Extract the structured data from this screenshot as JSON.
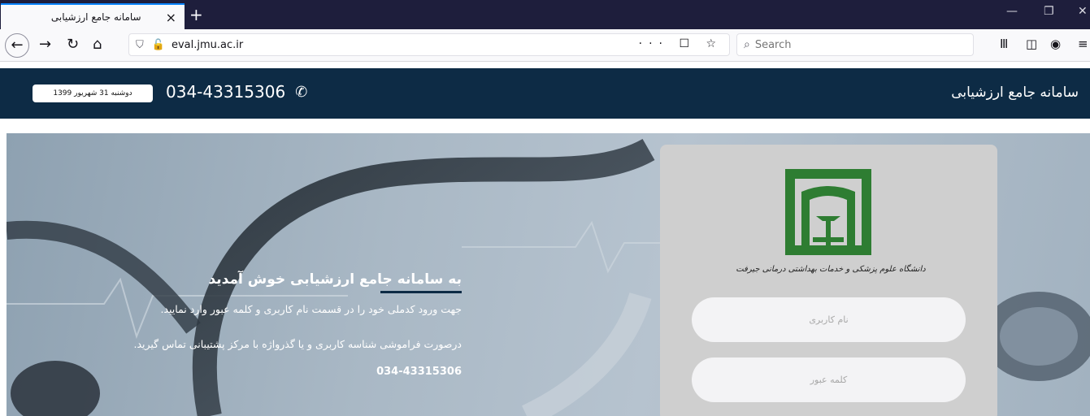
{
  "browser": {
    "tab_title": "سامانه جامع ارزشیابی",
    "tab_close": "×",
    "new_tab": "+",
    "url": "eval.jmu.ac.ir",
    "url_actions": "··· ☐ ☆",
    "search_placeholder": "Search",
    "window_min": "—",
    "window_restore": "❐",
    "window_close": "✕"
  },
  "header": {
    "site_title": "سامانه جامع ارزشیابی",
    "phone": "034-43315306",
    "date": "دوشنبه 31 شهریور 1399"
  },
  "welcome": {
    "title": "به سامانه جامع ارزشیابی خوش آمدید",
    "paragraph1": "جهت ورود کدملی خود را در قسمت نام کاربری و کلمه عبور وارد نمایید.",
    "paragraph2": "درصورت فراموشی شناسه کاربری و یا گذرواژه با مرکز پشتیبانی تماس گیرید.",
    "phone": "034-43315306"
  },
  "login": {
    "logo_caption": "دانشگاه علوم پزشکی و خدمات بهداشتی درمانی جیرفت",
    "username_placeholder": "نام کاربری",
    "password_placeholder": "کلمه عبور"
  },
  "colors": {
    "header_bg": "#0d2b45",
    "logo_green": "#2e7d32",
    "card_bg": "#cfcfcf"
  }
}
